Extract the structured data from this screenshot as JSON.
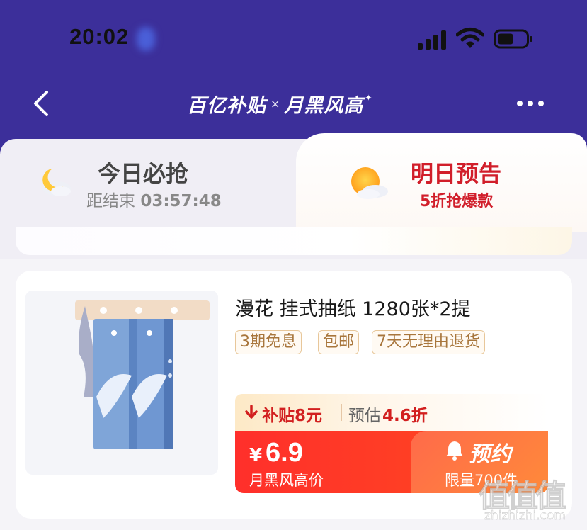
{
  "status_bar": {
    "time": "20:02"
  },
  "header": {
    "logo_brand": "百亿补贴",
    "logo_sep": "×",
    "logo_event": "月黑风高",
    "logo_spark": "✦"
  },
  "tabs": {
    "today": {
      "title": "今日必抢",
      "countdown_label": "距结束",
      "countdown": "03:57:48"
    },
    "tomorrow": {
      "title": "明日预告",
      "subtitle": "5折抢爆款"
    }
  },
  "product": {
    "title": "漫花  挂式抽纸  1280张*2提",
    "tags": [
      "3期免息",
      "包邮",
      "7天无理由退货"
    ],
    "subsidy": "补贴8元",
    "estimate_label": "预估",
    "estimate_value": "4.6折",
    "currency": "¥",
    "price": "6.9",
    "price_label": "月黑风高价",
    "reserve_label": "预约",
    "limit_label": "限量700件"
  },
  "watermark": {
    "logo": "值值值",
    "url": "zhizhizhi.com"
  },
  "colors": {
    "header_bg": "#3c2f9a",
    "accent_red": "#d11e2a",
    "buy_red": "#ff3a26",
    "tag_border": "#e8c79a"
  }
}
